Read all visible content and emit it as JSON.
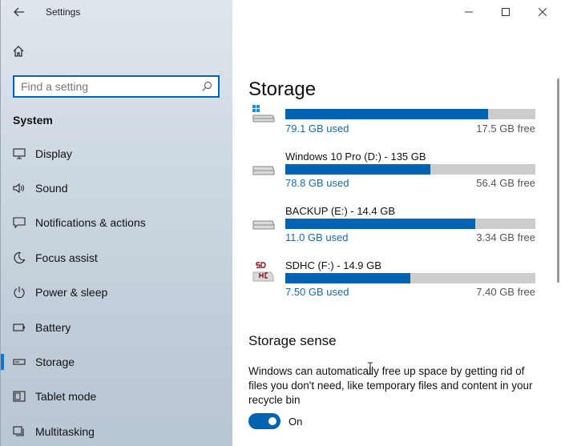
{
  "window": {
    "title": "Settings"
  },
  "sidebar": {
    "search_placeholder": "Find a setting",
    "section": "System",
    "items": [
      {
        "label": "Display",
        "icon": "monitor-icon"
      },
      {
        "label": "Sound",
        "icon": "speaker-icon"
      },
      {
        "label": "Notifications & actions",
        "icon": "notification-icon"
      },
      {
        "label": "Focus assist",
        "icon": "moon-icon"
      },
      {
        "label": "Power & sleep",
        "icon": "power-icon"
      },
      {
        "label": "Battery",
        "icon": "battery-icon"
      },
      {
        "label": "Storage",
        "icon": "storage-icon",
        "active": true
      },
      {
        "label": "Tablet mode",
        "icon": "tablet-icon"
      },
      {
        "label": "Multitasking",
        "icon": "multitasking-icon"
      }
    ]
  },
  "main": {
    "title": "Storage",
    "drives": [
      {
        "name": "",
        "used": "79.1 GB used",
        "free": "17.5 GB free",
        "fraction": 0.81,
        "icon": "windows-drive-icon"
      },
      {
        "name": "Windows 10 Pro (D:) - 135 GB",
        "used": "78.8 GB used",
        "free": "56.4 GB free",
        "fraction": 0.58,
        "icon": "drive-icon"
      },
      {
        "name": "BACKUP (E:) - 14.4 GB",
        "used": "11.0 GB used",
        "free": "3.34 GB free",
        "fraction": 0.76,
        "icon": "drive-icon"
      },
      {
        "name": "SDHC (F:) - 14.9 GB",
        "used": "7.50 GB used",
        "free": "7.40 GB free",
        "fraction": 0.5,
        "icon": "sdhc-card-icon"
      }
    ],
    "storage_sense": {
      "title": "Storage sense",
      "description": "Windows can automatically free up space by getting rid of files you don't need, like temporary files and content in your recycle bin",
      "toggle_label": "On",
      "toggle_on": true
    }
  },
  "colors": {
    "accent": "#0063b1",
    "bar_bg": "#cccccc",
    "used_text": "#1a6aa8"
  }
}
